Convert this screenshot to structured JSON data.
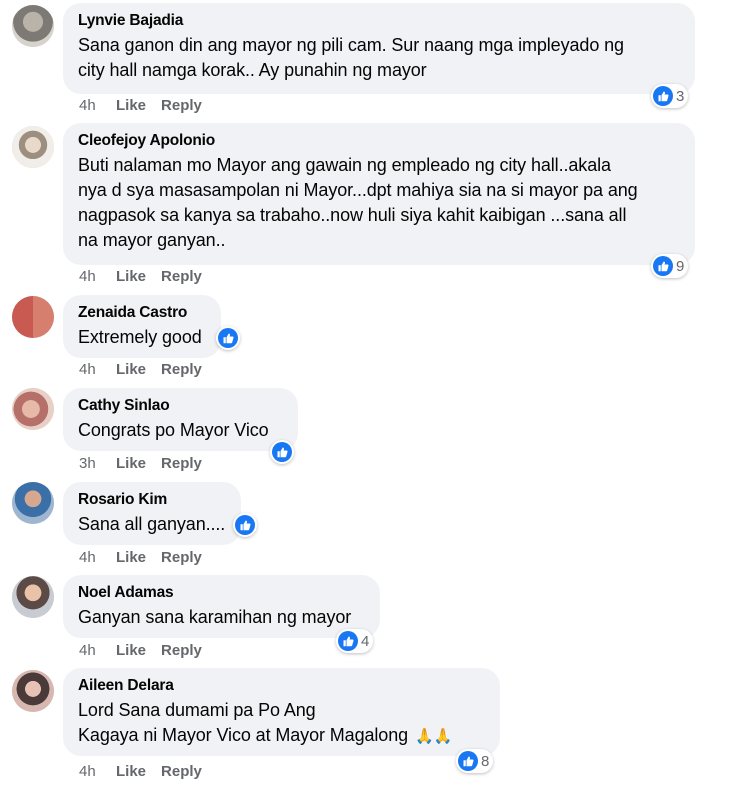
{
  "colors": {
    "like_blue": "#1877f2",
    "bubble_bg": "#f0f2f5",
    "meta_text": "#65676b"
  },
  "comments": [
    {
      "author": "Lynvie Bajadia",
      "lines": [
        "Sana ganon din ang mayor ng pili cam. Sur naang mga impleyado ng",
        "city hall namga korak.. Ay punahin ng mayor"
      ],
      "time": "4h",
      "like_label": "Like",
      "reply_label": "Reply",
      "reaction_count": "3",
      "reaction_icon": "like-icon"
    },
    {
      "author": "Cleofejoy Apolonio",
      "lines": [
        "Buti nalaman mo Mayor ang gawain ng empleado ng city hall..akala",
        "nya d sya masasampolan ni Mayor...dpt mahiya sia na si mayor pa ang",
        "nagpasok sa kanya sa trabaho..now huli siya kahit kaibigan ...sana all",
        "na mayor ganyan.."
      ],
      "time": "4h",
      "like_label": "Like",
      "reply_label": "Reply",
      "reaction_count": "9",
      "reaction_icon": "like-icon"
    },
    {
      "author": "Zenaida Castro",
      "lines": [
        "Extremely good"
      ],
      "time": "4h",
      "like_label": "Like",
      "reply_label": "Reply",
      "reaction_count": "",
      "reaction_icon": "like-icon"
    },
    {
      "author": "Cathy Sinlao",
      "lines": [
        "Congrats po Mayor Vico"
      ],
      "time": "3h",
      "like_label": "Like",
      "reply_label": "Reply",
      "reaction_count": "",
      "reaction_icon": "like-icon"
    },
    {
      "author": "Rosario Kim",
      "lines": [
        "Sana all ganyan...."
      ],
      "time": "4h",
      "like_label": "Like",
      "reply_label": "Reply",
      "reaction_count": "",
      "reaction_icon": "like-icon"
    },
    {
      "author": "Noel Adamas",
      "lines": [
        "Ganyan sana karamihan ng mayor"
      ],
      "time": "4h",
      "like_label": "Like",
      "reply_label": "Reply",
      "reaction_count": "4",
      "reaction_icon": "like-icon"
    },
    {
      "author": "Aileen Delara",
      "lines": [
        "Lord Sana dumami pa Po Ang",
        "Kagaya ni Mayor Vico at Mayor Magalong"
      ],
      "emoji": "🙏🙏",
      "time": "4h",
      "like_label": "Like",
      "reply_label": "Reply",
      "reaction_count": "8",
      "reaction_icon": "like-icon"
    }
  ]
}
